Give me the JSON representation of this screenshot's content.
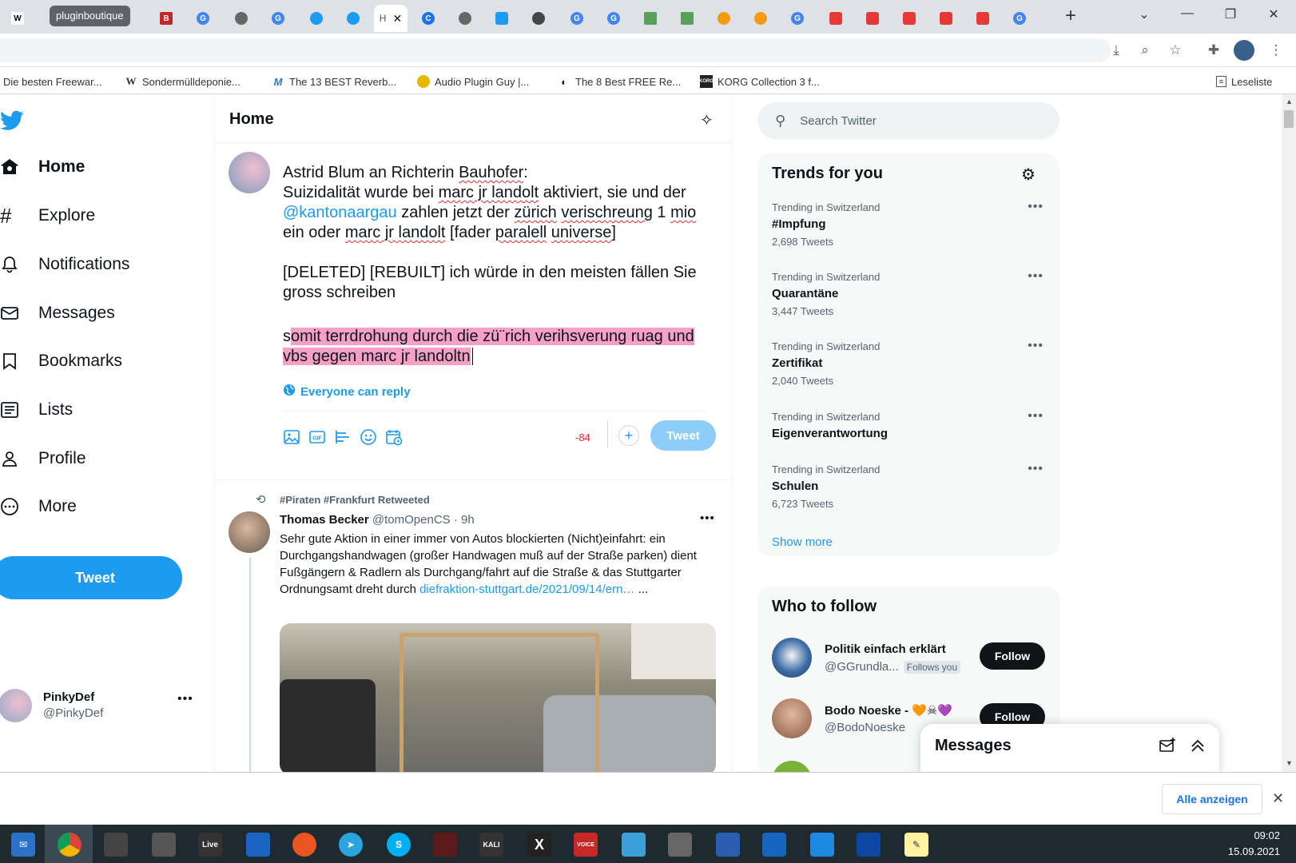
{
  "browser": {
    "tab_group_label": "pluginboutique",
    "active_tab_title": "H",
    "bookmarks": [
      {
        "label": "Die besten Freewar...",
        "icon": "page-icon"
      },
      {
        "label": "Sondermülldeponie...",
        "icon": "wikipedia-icon"
      },
      {
        "label": "The 13 BEST Reverb...",
        "icon": "m-logo-icon"
      },
      {
        "label": "Audio Plugin Guy |...",
        "icon": "face-icon"
      },
      {
        "label": "The 8 Best FREE Re...",
        "icon": "moon-icon"
      },
      {
        "label": "KORG Collection 3 f...",
        "icon": "korg-icon"
      }
    ],
    "reading_list": "Leseliste"
  },
  "sidebar": {
    "items": [
      {
        "label": "Home",
        "icon": "home-icon"
      },
      {
        "label": "Explore",
        "icon": "hashtag-icon"
      },
      {
        "label": "Notifications",
        "icon": "bell-icon"
      },
      {
        "label": "Messages",
        "icon": "envelope-icon"
      },
      {
        "label": "Bookmarks",
        "icon": "bookmark-icon"
      },
      {
        "label": "Lists",
        "icon": "list-icon"
      },
      {
        "label": "Profile",
        "icon": "person-icon"
      },
      {
        "label": "More",
        "icon": "more-circle-icon"
      }
    ],
    "tweet_button": "Tweet",
    "account": {
      "name": "PinkyDef",
      "handle": "@PinkyDef"
    }
  },
  "header": {
    "title": "Home"
  },
  "compose": {
    "line1": "Astrid Blum an Richterin ",
    "line1_sq": "Bauhofer",
    "line1_end": ":",
    "line2a": "Suizidalität wurde bei ",
    "line2_sq": "marc jr landolt",
    "line2b": " aktiviert, sie und der ",
    "mention": "@kantonaargau",
    "line2c": " zahlen jetzt der ",
    "line2_sq2": "zürich",
    "line2d": " ",
    "line2_sq3": "verischreung",
    "line2e": " 1 ",
    "line2_sq4": "mio",
    "line2f": " ein oder ",
    "line2_sq5": "marc jr landolt",
    "line2g": " [fader ",
    "line2_sq6": "paralell",
    "line2h": " ",
    "line2_sq7": "universe",
    "line2i": "]",
    "para2": "[DELETED] [REBUILT] ich würde in den meisten fällen Sie gross schreiben",
    "para3_first": "s",
    "para3_rest": "omit terrdrohung durch die zü¨rich verihsverung ruag und vbs gegen marc jr landoltn",
    "reply_setting": "Everyone can reply",
    "char_count": "-84",
    "tweet_label": "Tweet",
    "tools": [
      "image-icon",
      "gif-icon",
      "poll-icon",
      "emoji-icon",
      "schedule-icon"
    ]
  },
  "feed": {
    "retweet_context": "#Piraten #Frankfurt Retweeted",
    "author_name": "Thomas Becker",
    "author_handle": "@tomOpenCS",
    "time": "· 9h",
    "text": "Sehr gute Aktion in einer immer von Autos blockierten (Nicht)einfahrt: ein Durchgangshandwagen (großer Handwagen muß auf der Straße parken) dient Fußgängern & Radlern als Durchgang/fahrt auf die Straße & das Stuttgarter Ordnungsamt dreht durch ",
    "link": "diefraktion-stuttgart.de/2021/09/14/ern…",
    "link_tail": " ..."
  },
  "right": {
    "search_placeholder": "Search Twitter",
    "trends_title": "Trends for you",
    "trends": [
      {
        "context": "Trending in Switzerland",
        "name": "#Impfung",
        "count": "2,698 Tweets"
      },
      {
        "context": "Trending in Switzerland",
        "name": "Quarantäne",
        "count": "3,447 Tweets"
      },
      {
        "context": "Trending in Switzerland",
        "name": "Zertifikat",
        "count": "2,040 Tweets"
      },
      {
        "context": "Trending in Switzerland",
        "name": "Eigenverantwortung",
        "count": ""
      },
      {
        "context": "Trending in Switzerland",
        "name": "Schulen",
        "count": "6,723 Tweets"
      }
    ],
    "show_more": "Show more",
    "who_title": "Who to follow",
    "follows": [
      {
        "name": "Politik einfach erklärt",
        "handle": "@GGrundla...",
        "badge": "Follows you",
        "button": "Follow"
      },
      {
        "name": "Bodo Noeske -",
        "emoji": "🧡☠💜",
        "handle": "@BodoNoeske",
        "button": "Follow"
      }
    ],
    "messages_drawer": "Messages"
  },
  "downloads": {
    "show_all": "Alle anzeigen"
  },
  "taskbar": {
    "time": "09:02",
    "date": "15.09.2021"
  },
  "colors": {
    "twitter_blue": "#1d9bf0",
    "highlight": "#f6a0c7",
    "char_count_red": "#f4212e"
  }
}
